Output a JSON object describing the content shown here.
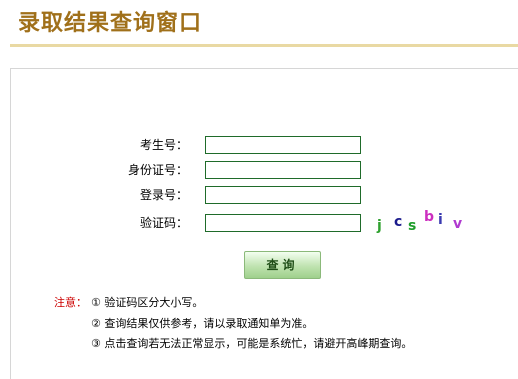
{
  "page": {
    "title": "录取结果查询窗口"
  },
  "form": {
    "candidate_no": {
      "label": "考生号：",
      "value": ""
    },
    "id_no": {
      "label": "身份证号：",
      "value": ""
    },
    "login_no": {
      "label": "登录号：",
      "value": ""
    },
    "captcha": {
      "label": "验证码：",
      "value": "",
      "chars": [
        {
          "ch": "j",
          "color": "#2fa12f"
        },
        {
          "ch": "c",
          "color": "#1a1a8c"
        },
        {
          "ch": "s",
          "color": "#1f9e2b"
        },
        {
          "ch": "b",
          "color": "#cc2fbf"
        },
        {
          "ch": "i",
          "color": "#3a3ab0"
        },
        {
          "ch": "v",
          "color": "#b03ad0"
        }
      ]
    },
    "submit_label": "查询"
  },
  "notes": {
    "label": "注意：",
    "items": [
      "① 验证码区分大小写。",
      "② 查询结果仅供参考，请以录取通知单为准。",
      "③ 点击查询若无法正常显示，可能是系统忙，请避开高峰期查询。"
    ]
  }
}
